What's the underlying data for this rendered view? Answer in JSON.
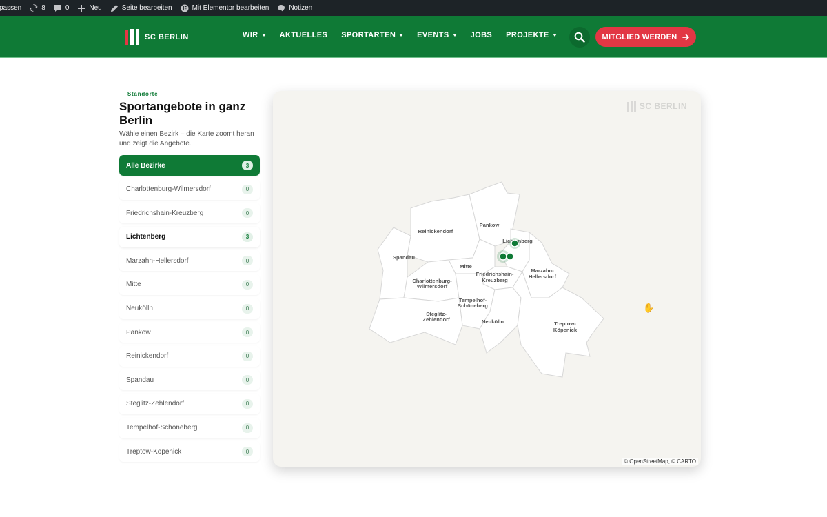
{
  "adminbar": {
    "items": [
      {
        "label": "passen",
        "icon": "customize-icon"
      },
      {
        "label": "8",
        "icon": "updates-icon"
      },
      {
        "label": "0",
        "icon": "comments-icon"
      },
      {
        "label": "Neu",
        "icon": "plus-icon"
      },
      {
        "label": "Seite bearbeiten",
        "icon": "pencil-icon"
      },
      {
        "label": "Mit Elementor bearbeiten",
        "icon": "elementor-icon"
      },
      {
        "label": "Notizen",
        "icon": "speech-bubble-icon"
      }
    ]
  },
  "header": {
    "logo_text": "SC BERLIN",
    "nav": [
      {
        "label": "WIR",
        "dropdown": true
      },
      {
        "label": "AKTUELLES",
        "dropdown": false
      },
      {
        "label": "SPORTARTEN",
        "dropdown": true
      },
      {
        "label": "EVENTS",
        "dropdown": true
      },
      {
        "label": "JOBS",
        "dropdown": false
      },
      {
        "label": "PROJEKTE",
        "dropdown": true
      }
    ],
    "cta_label": "MITGLIED WERDEN",
    "colors": {
      "brand": "#0f7a36",
      "accent": "#e23744"
    }
  },
  "panel": {
    "eyebrow": "— Standorte",
    "title": "Sportangebote in ganz Berlin",
    "subtitle": "Wähle einen Bezirk – die Karte zoomt heran und zeigt die Angebote."
  },
  "districts": [
    {
      "name": "Alle Bezirke",
      "count": "3",
      "state": "active"
    },
    {
      "name": "Charlottenburg-Wilmersdorf",
      "count": "0",
      "state": ""
    },
    {
      "name": "Friedrichshain-Kreuzberg",
      "count": "0",
      "state": ""
    },
    {
      "name": "Lichtenberg",
      "count": "3",
      "state": "has"
    },
    {
      "name": "Marzahn-Hellersdorf",
      "count": "0",
      "state": ""
    },
    {
      "name": "Mitte",
      "count": "0",
      "state": ""
    },
    {
      "name": "Neukölln",
      "count": "0",
      "state": ""
    },
    {
      "name": "Pankow",
      "count": "0",
      "state": ""
    },
    {
      "name": "Reinickendorf",
      "count": "0",
      "state": ""
    },
    {
      "name": "Spandau",
      "count": "0",
      "state": ""
    },
    {
      "name": "Steglitz-Zehlendorf",
      "count": "0",
      "state": ""
    },
    {
      "name": "Tempelhof-Schöneberg",
      "count": "0",
      "state": ""
    },
    {
      "name": "Treptow-Köpenick",
      "count": "0",
      "state": ""
    }
  ],
  "map": {
    "watermark": "SC BERLIN",
    "attribution": "© OpenStreetMap, © CARTO",
    "labels": {
      "reinickendorf": "Reinickendorf",
      "pankow": "Pankow",
      "lichtenberg": "Lichtenberg",
      "spandau": "Spandau",
      "mitte": "Mitte",
      "charlottenburg_1": "Charlottenburg-",
      "charlottenburg_2": "Wilmersdorf",
      "friedrichshain_1": "Friedrichshain-",
      "friedrichshain_2": "Kreuzberg",
      "marzahn_1": "Marzahn-",
      "marzahn_2": "Hellersdorf",
      "tempelhof_1": "Tempelhof-",
      "tempelhof_2": "Schöneberg",
      "steglitz_1": "Steglitz-",
      "steglitz_2": "Zehlendorf",
      "neukoelln": "Neukölln",
      "treptow_1": "Treptow-",
      "treptow_2": "Köpenick"
    },
    "marker_color": "#0f7a36"
  }
}
